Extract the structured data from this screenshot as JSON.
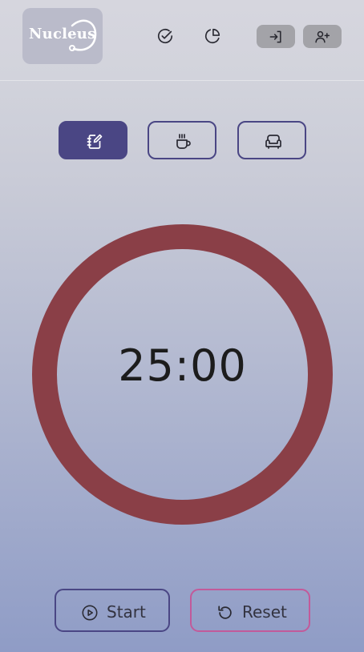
{
  "header": {
    "logo_text": "Nucleus",
    "nav_icons": [
      "check-circle-icon",
      "pie-chart-icon"
    ],
    "auth_icons": [
      "login-icon",
      "add-user-icon"
    ]
  },
  "modes": [
    {
      "icon": "notebook-edit-icon",
      "active": true
    },
    {
      "icon": "coffee-cup-icon",
      "active": false
    },
    {
      "icon": "armchair-icon",
      "active": false
    }
  ],
  "timer": {
    "display": "25:00",
    "progress_fraction": 1.0,
    "ring_color": "#8a3f47"
  },
  "controls": {
    "start_label": "Start",
    "reset_label": "Reset"
  },
  "colors": {
    "accent": "#4a4684",
    "reset_border": "#c25a9a",
    "auth_button_bg": "#a3a3a8"
  }
}
